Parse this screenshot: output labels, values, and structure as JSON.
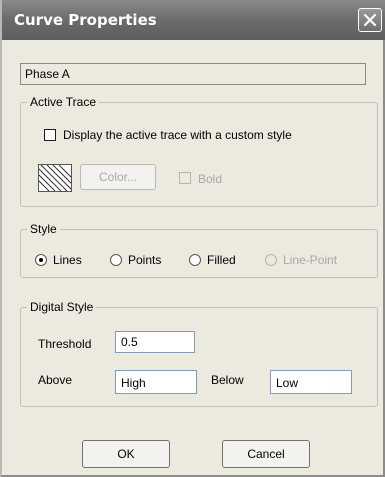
{
  "window": {
    "title": "Curve Properties",
    "close_icon": "close-icon"
  },
  "curve_name": "Phase A",
  "active_trace": {
    "legend": "Active Trace",
    "custom_style_label": "Display the active trace with a custom style",
    "custom_style_checked": false,
    "swatch_icon": "hatch-pattern-icon",
    "color_button": "Color...",
    "bold_label": "Bold",
    "bold_checked": false
  },
  "style": {
    "legend": "Style",
    "options": [
      {
        "label": "Lines",
        "selected": true,
        "enabled": true
      },
      {
        "label": "Points",
        "selected": false,
        "enabled": true
      },
      {
        "label": "Filled",
        "selected": false,
        "enabled": true
      },
      {
        "label": "Line-Point",
        "selected": false,
        "enabled": false
      }
    ]
  },
  "digital_style": {
    "legend": "Digital Style",
    "threshold_label": "Threshold",
    "threshold_value": "0.5",
    "above_label": "Above",
    "above_value": "High",
    "below_label": "Below",
    "below_value": "Low"
  },
  "buttons": {
    "ok": "OK",
    "cancel": "Cancel"
  },
  "colors": {
    "dialog_bg": "#ece9df",
    "titlebar": "#6b6b6b",
    "disabled_text": "#a8a8a8"
  }
}
